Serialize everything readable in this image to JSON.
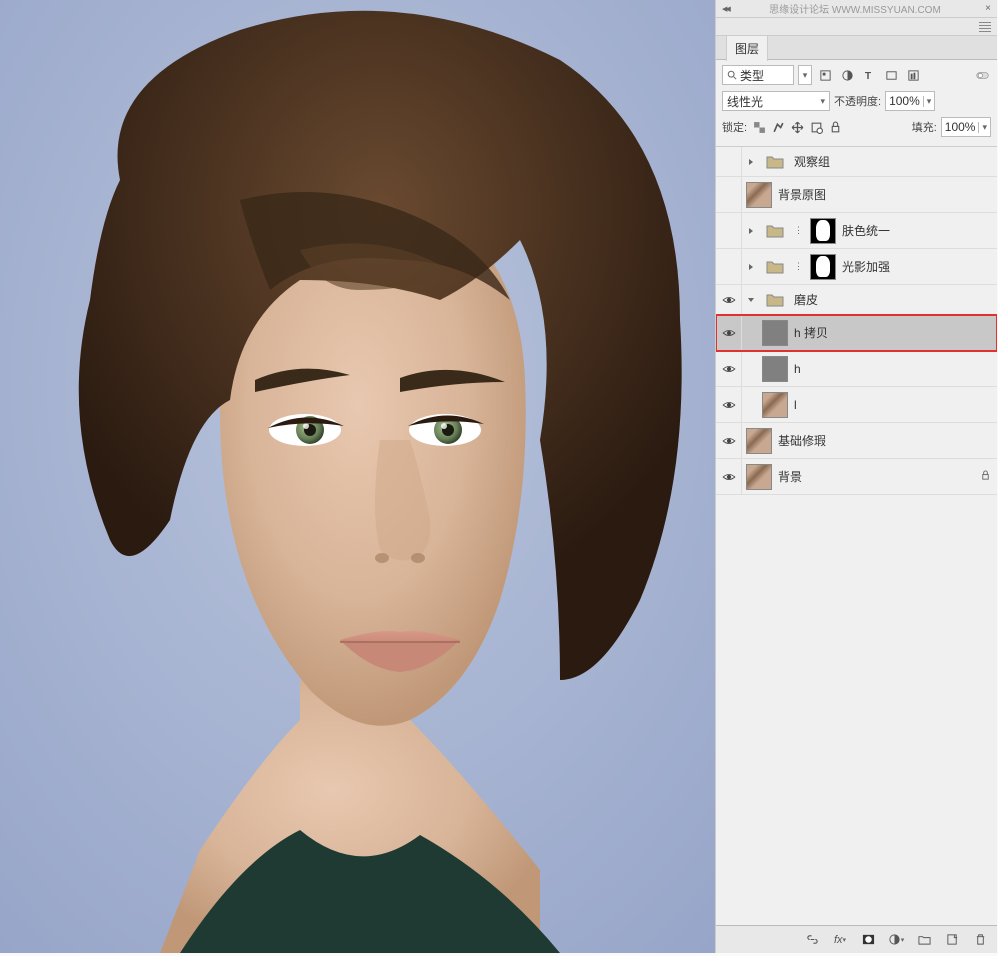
{
  "watermark": {
    "text": "思缘设计论坛",
    "url": "WWW.MISSYUAN.COM"
  },
  "panel": {
    "tab": "图层",
    "close": "×"
  },
  "filter": {
    "search_label": "类型"
  },
  "blend": {
    "mode": "线性光",
    "opacity_label": "不透明度:",
    "opacity_value": "100%",
    "lock_label": "锁定:",
    "fill_label": "填充:",
    "fill_value": "100%"
  },
  "layers": [
    {
      "id": "g-observe",
      "visible": false,
      "indent": 0,
      "type": "group-closed",
      "name": "观察组",
      "short": true
    },
    {
      "id": "l-bg-orig",
      "visible": false,
      "indent": 0,
      "type": "portrait",
      "name": "背景原图"
    },
    {
      "id": "g-skin",
      "visible": false,
      "indent": 0,
      "type": "group-masked",
      "name": "肤色统一"
    },
    {
      "id": "g-light",
      "visible": false,
      "indent": 0,
      "type": "group-masked",
      "name": "光影加强"
    },
    {
      "id": "g-retouch",
      "visible": true,
      "indent": 0,
      "type": "group-open",
      "name": "磨皮",
      "short": true
    },
    {
      "id": "l-hcopy",
      "visible": true,
      "indent": 1,
      "type": "gray-highlighted",
      "name": "h 拷贝",
      "selected": true
    },
    {
      "id": "l-h",
      "visible": true,
      "indent": 1,
      "type": "gray",
      "name": "h"
    },
    {
      "id": "l-l",
      "visible": true,
      "indent": 1,
      "type": "portrait",
      "name": "l"
    },
    {
      "id": "l-basefix",
      "visible": true,
      "indent": 0,
      "type": "portrait",
      "name": "基础修瑕"
    },
    {
      "id": "l-bg",
      "visible": true,
      "indent": 0,
      "type": "portrait",
      "name": "背景",
      "locked": true
    }
  ],
  "footer_icons": [
    "link",
    "fx",
    "mask",
    "adjust",
    "group",
    "new",
    "trash"
  ]
}
